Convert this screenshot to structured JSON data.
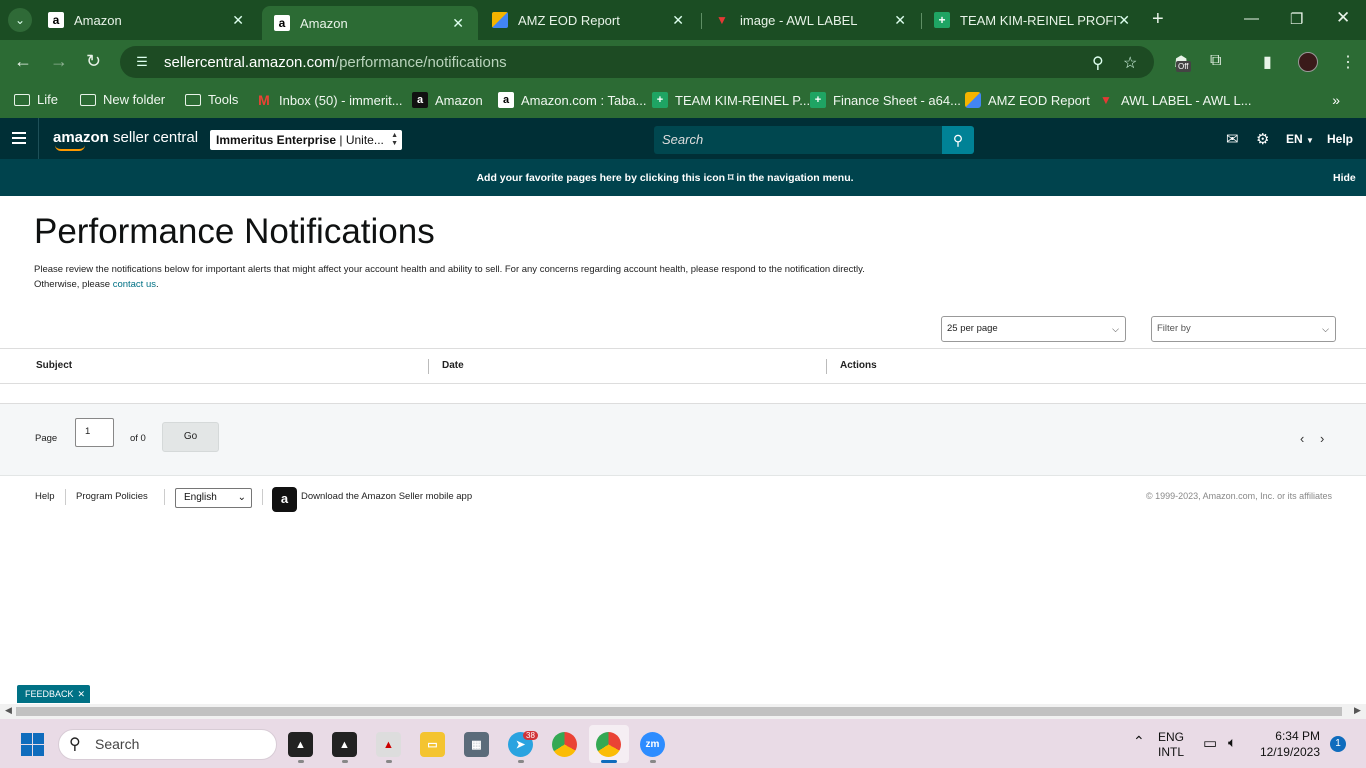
{
  "browser": {
    "tabs": [
      {
        "title": "Amazon",
        "active": false
      },
      {
        "title": "Amazon",
        "active": true
      },
      {
        "title": "AMZ EOD Report",
        "active": false
      },
      {
        "title": "image - AWL LABEL",
        "active": false
      },
      {
        "title": "TEAM KIM-REINEL PROFIT S",
        "active": false
      }
    ],
    "url_host": "sellercentral.amazon.com",
    "url_path": "/performance/notifications",
    "extension_badge": "Off",
    "bookmarks": [
      {
        "label": "Life",
        "icon": "folder-icon"
      },
      {
        "label": "New folder",
        "icon": "folder-icon"
      },
      {
        "label": "Tools",
        "icon": "folder-icon"
      },
      {
        "label": "Inbox (50) - immerit...",
        "icon": "gmail-icon"
      },
      {
        "label": "Amazon",
        "icon": "amazon-icon"
      },
      {
        "label": "Amazon.com : Taba...",
        "icon": "amazon-icon"
      },
      {
        "label": "TEAM KIM-REINEL P...",
        "icon": "sheets-icon"
      },
      {
        "label": "Finance Sheet - a64...",
        "icon": "sheets-icon"
      },
      {
        "label": "AMZ EOD Report",
        "icon": "eod-icon"
      },
      {
        "label": "AWL LABEL - AWL L...",
        "icon": "awl-icon"
      }
    ]
  },
  "seller_central": {
    "logo_bold": "amazon",
    "logo_rest": " seller central",
    "store_name": "Immeritus Enterprise",
    "store_sep": " | ",
    "store_region": "Unite...",
    "search_placeholder": "Search",
    "lang": "EN",
    "help": "Help"
  },
  "favorites_banner": {
    "text_before": "Add your favorite pages here by clicking this icon ",
    "text_after": " in the navigation menu.",
    "hide": "Hide"
  },
  "page": {
    "title": "Performance Notifications",
    "intro": "Please review the notifications below for important alerts that might affect your account health and ability to sell. For any concerns regarding account health, please respond to the notification directly. Otherwise, please ",
    "contact_link": "contact us",
    "intro_end": ".",
    "per_page": "25 per page",
    "filter_placeholder": "Filter by",
    "columns": [
      "Subject",
      "Date",
      "Actions"
    ]
  },
  "pager": {
    "page_label": "Page",
    "page_value": "1",
    "of_label": "of 0",
    "go": "Go"
  },
  "footer": {
    "help": "Help",
    "program_policies": "Program Policies",
    "language": "English",
    "app_text": "Download the Amazon Seller mobile app",
    "copyright": "© 1999-2023, Amazon.com, Inc. or its affiliates"
  },
  "feedback": "FEEDBACK",
  "taskbar": {
    "search_placeholder": "Search",
    "telegram_badge": "38",
    "lang_line1": "ENG",
    "lang_line2": "INTL",
    "time": "6:34 PM",
    "date": "12/19/2023",
    "notifications": "1"
  },
  "colors": {
    "chrome_frame": "#1b4d23",
    "chrome_toolbar": "#2c6b34",
    "sc_header": "#002f36",
    "sc_banner": "#00434d",
    "sc_accent": "#008296",
    "link": "#007185"
  }
}
